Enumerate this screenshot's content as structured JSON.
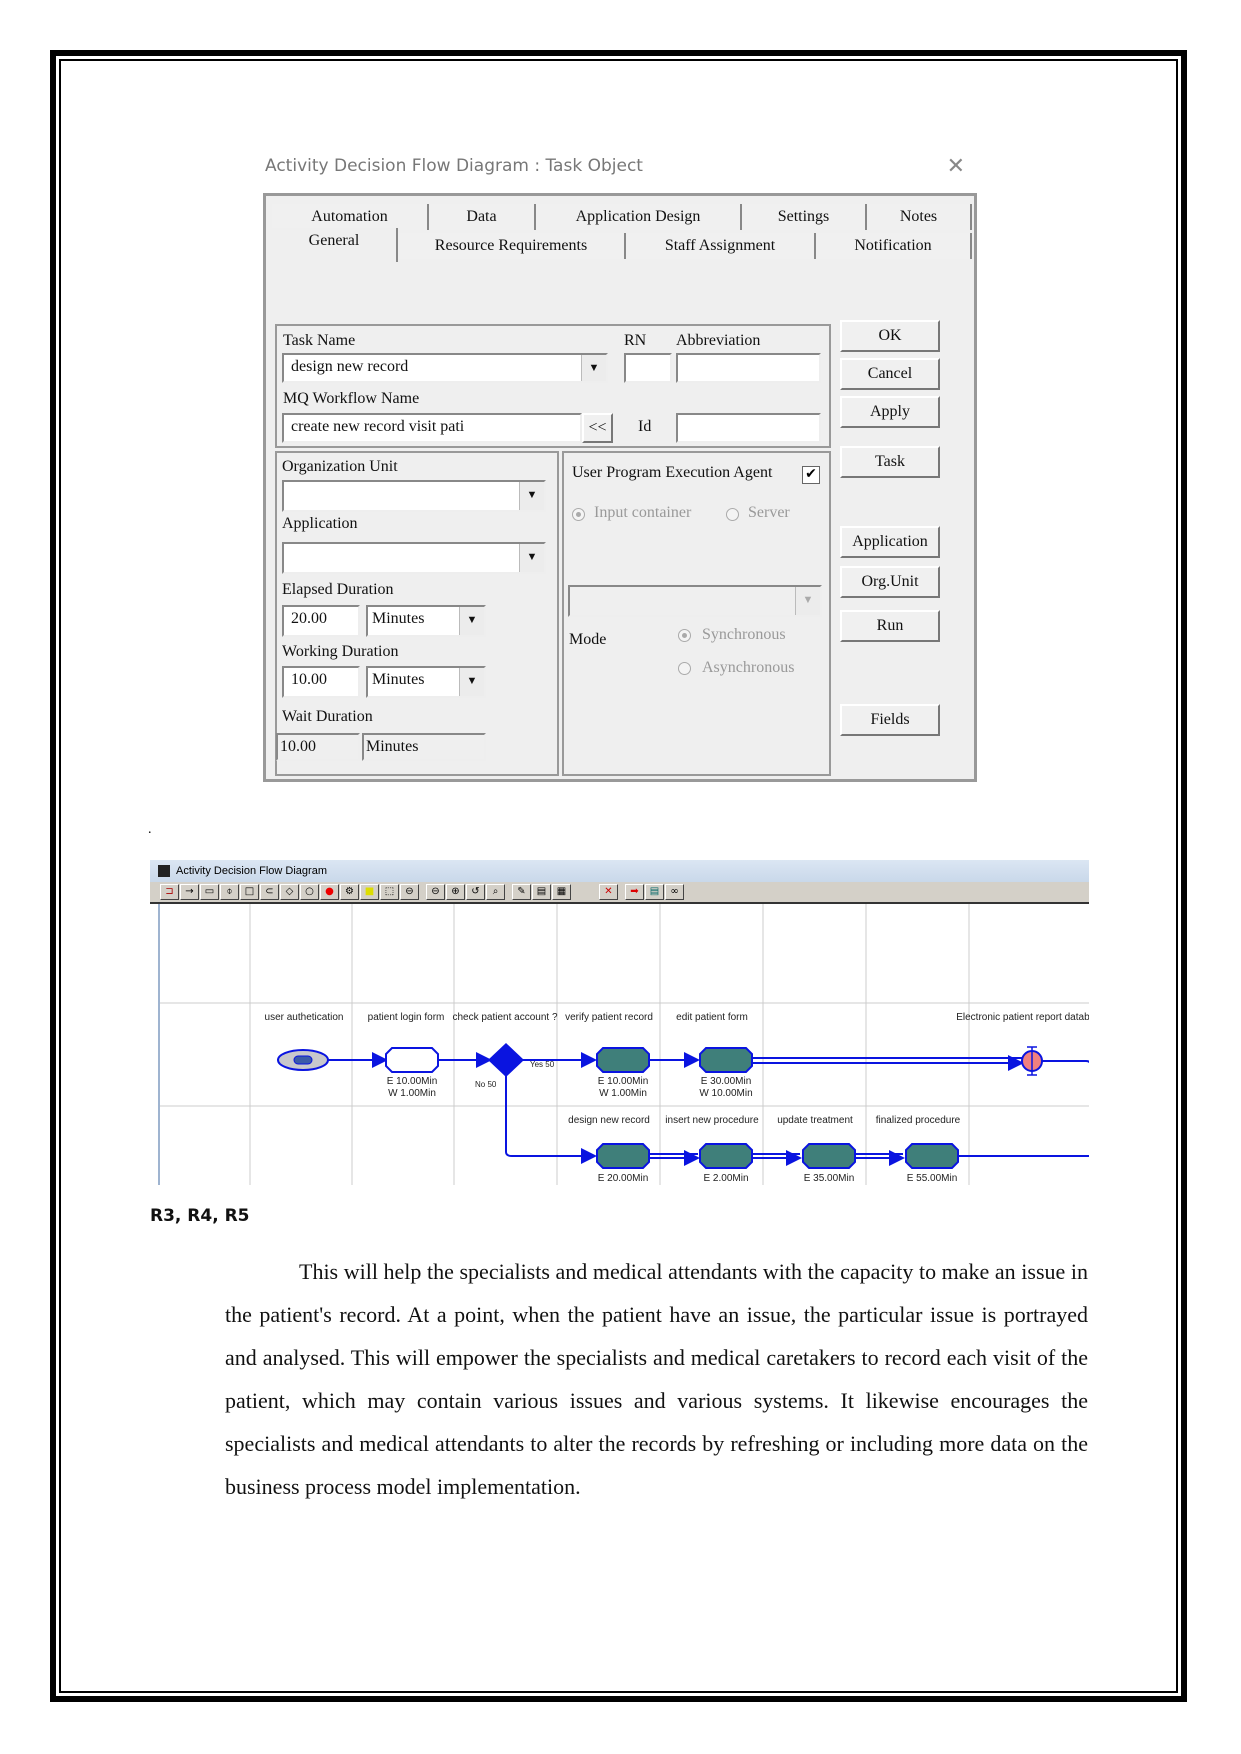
{
  "dialog": {
    "title": "Activity Decision Flow Diagram : Task  Object",
    "close_icon": "close-icon",
    "tabs_row1": [
      "Automation",
      "Data",
      "Application Design",
      "Settings",
      "Notes"
    ],
    "tabs_row2": [
      "General",
      "Resource Requirements",
      "Staff Assignment",
      "Notification"
    ],
    "active_tab": "General",
    "task_name_label": "Task Name",
    "task_name_value": "design new record",
    "rn_label": "RN",
    "rn_value": "",
    "abbreviation_label": "Abbreviation",
    "abbreviation_value": "",
    "mq_workflow_label": "MQ Workflow Name",
    "mq_workflow_value": "create new record visit pati",
    "mq_button_label": "<<",
    "id_label": "Id",
    "id_value": "",
    "org_unit_label": "Organization Unit",
    "org_unit_value": "",
    "application_label": "Application",
    "application_value": "",
    "elapsed_label": "Elapsed Duration",
    "elapsed_value": "20.00",
    "elapsed_unit": "Minutes",
    "working_label": "Working Duration",
    "working_value": "10.00",
    "working_unit": "Minutes",
    "wait_label": "Wait Duration",
    "wait_value": "10.00",
    "wait_unit": "Minutes",
    "upea_label": "User Program Execution Agent",
    "upea_checked": "✔",
    "radio_input_container": "Input container",
    "radio_server": "Server",
    "agent_select_value": "",
    "mode_label": "Mode",
    "radio_synchronous": "Synchronous",
    "radio_asynchronous": "Asynchronous",
    "buttons": {
      "ok": "OK",
      "cancel": "Cancel",
      "apply": "Apply",
      "task": "Task",
      "application": "Application",
      "org_unit": "Org.Unit",
      "run": "Run",
      "fields": "Fields"
    }
  },
  "separator_dot": ".",
  "diagram": {
    "title": "Activity Decision Flow Diagram",
    "toolbar_icons": [
      "select-icon",
      "arrow-icon",
      "rect-icon",
      "split-icon",
      "box-icon",
      "rounded-icon",
      "diamond-icon",
      "circle-icon",
      "stop-icon",
      "gear-icon",
      "note-icon",
      "marquee-icon",
      "connector-icon",
      "zoom-out-icon",
      "zoom-in-icon",
      "undo-icon",
      "find-icon",
      "pencil-icon",
      "ruler-icon",
      "layers-icon",
      "fit-icon",
      "export-icon",
      "print-icon",
      "binoculars-icon"
    ],
    "lane_top_labels": [
      "user authetication",
      "patient login form",
      "check patient account ?",
      "verify patient record",
      "edit patient form",
      "Electronic patient report database"
    ],
    "lane_bottom_labels": [
      "design new record",
      "insert new procedure",
      "update treatment",
      "finalized procedure"
    ],
    "patient_login_times": [
      "E  10.00Min",
      "W  1.00Min"
    ],
    "verify_times": [
      "E  10.00Min",
      "W  1.00Min"
    ],
    "edit_times": [
      "E  30.00Min",
      "W  10.00Min"
    ],
    "yes_label": "Yes 50",
    "no_label": "No 50",
    "bottom_times": [
      "E  20.00Min",
      "E  2.00Min",
      "E  35.00Min",
      "E  55.00Min"
    ],
    "colors": {
      "flow": "#0a14e0",
      "task_fill": "#3f7f7a",
      "db_fill": "#f08080"
    }
  },
  "requirements_heading": "R3, R4, R5",
  "paragraph": "This will help the specialists and medical attendants with the capacity to make an issue in the patient's record. At a point, when the patient have an issue, the particular issue is portrayed and analysed. This will empower the specialists and medical caretakers to record each visit of the patient, which may contain various issues and various systems. It likewise encourages the specialists and medical attendants to alter the records by refreshing or including more data on the business process model implementation."
}
